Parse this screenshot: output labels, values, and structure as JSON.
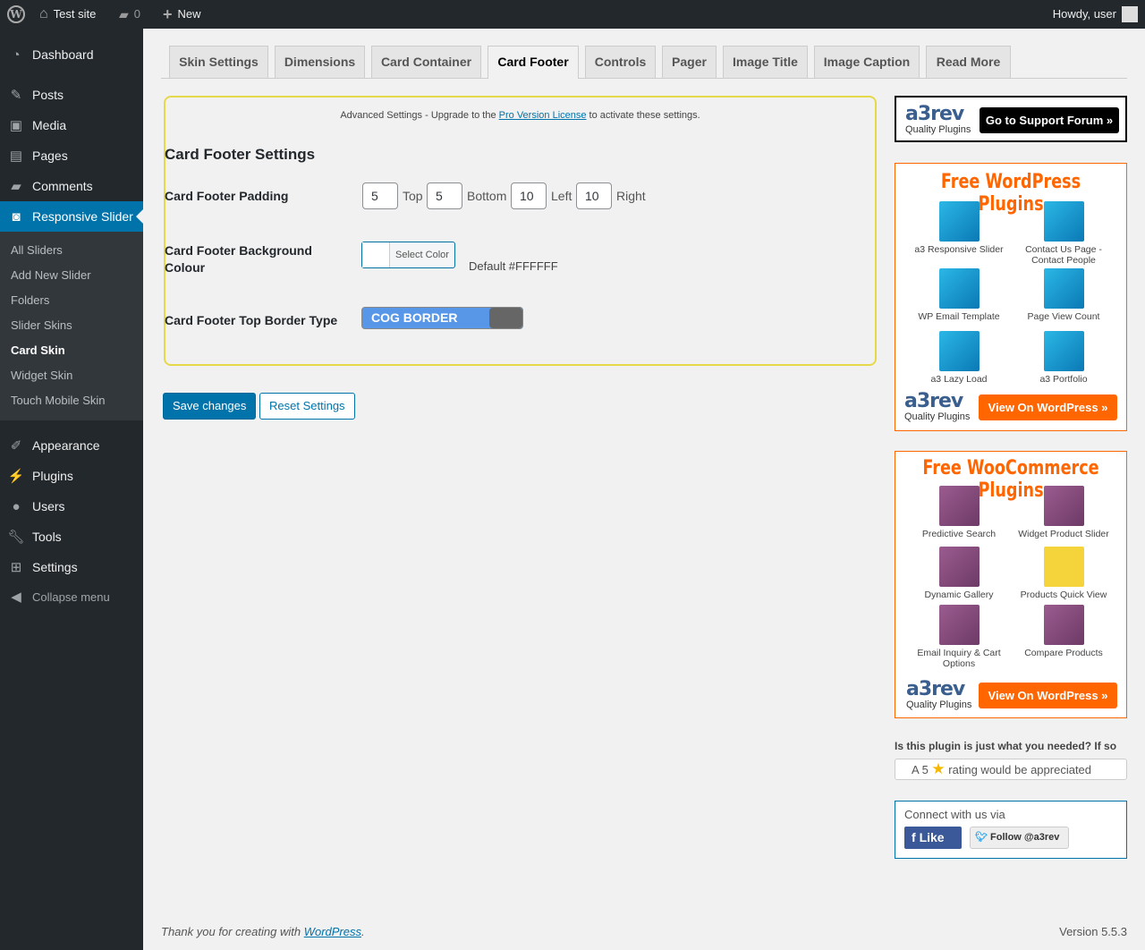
{
  "adminbar": {
    "site": "Test site",
    "comments": "0",
    "new": "New",
    "howdy": "Howdy, user"
  },
  "menu": {
    "dashboard": "Dashboard",
    "posts": "Posts",
    "media": "Media",
    "pages": "Pages",
    "comments": "Comments",
    "responsive_slider": "Responsive Slider",
    "appearance": "Appearance",
    "plugins": "Plugins",
    "users": "Users",
    "tools": "Tools",
    "settings": "Settings",
    "collapse": "Collapse menu"
  },
  "submenu": [
    "All Sliders",
    "Add New Slider",
    "Folders",
    "Slider Skins",
    "Card Skin",
    "Widget Skin",
    "Touch Mobile Skin"
  ],
  "tabs": [
    "Skin Settings",
    "Dimensions",
    "Card Container",
    "Card Footer",
    "Controls",
    "Pager",
    "Image Title",
    "Image Caption",
    "Read More"
  ],
  "notice": {
    "pre": "Advanced Settings - Upgrade to the ",
    "link": "Pro Version License",
    "post": " to activate these settings."
  },
  "section_title": "Card Footer Settings",
  "padding": {
    "label": "Card Footer Padding",
    "top": "5",
    "top_label": "Top",
    "bottom": "5",
    "bottom_label": "Bottom",
    "left": "10",
    "left_label": "Left",
    "right": "10",
    "right_label": "Right"
  },
  "bg_colour": {
    "label": "Card Footer Background Colour",
    "button": "Select Color",
    "default": "Default #FFFFFF",
    "color": "#FFFFFF"
  },
  "border_type": {
    "label": "Card Footer Top Border Type",
    "value": "COG BORDER"
  },
  "buttons": {
    "save": "Save changes",
    "reset": "Reset Settings"
  },
  "support": {
    "logo": "a3rev",
    "tagline": "Quality Plugins",
    "button": "Go to Support Forum »"
  },
  "wp_plugins": {
    "title": "Free WordPress Plugins",
    "items": [
      "a3 Responsive Slider",
      "Contact Us Page - Contact People",
      "WP Email Template",
      "Page View Count",
      "a3 Lazy Load",
      "a3 Portfolio"
    ],
    "logo": "a3rev",
    "tagline": "Quality Plugins",
    "button": "View On WordPress »"
  },
  "woo_plugins": {
    "title": "Free WooCommerce Plugins",
    "items": [
      "Predictive Search",
      "Widget Product Slider",
      "Dynamic Gallery",
      "Products Quick View",
      "Email Inquiry & Cart Options",
      "Compare Products"
    ],
    "logo": "a3rev",
    "tagline": "Quality Plugins",
    "button": "View On WordPress »"
  },
  "rating": {
    "question": "Is this plugin is just what you needed? If so",
    "pre": "A 5",
    "post": "rating would be appreciated"
  },
  "connect": {
    "title": "Connect with us via",
    "like": "Like",
    "follow": "Follow @a3rev"
  },
  "footer": {
    "thanks": "Thank you for creating with ",
    "link": "WordPress",
    "version": "Version 5.5.3"
  }
}
